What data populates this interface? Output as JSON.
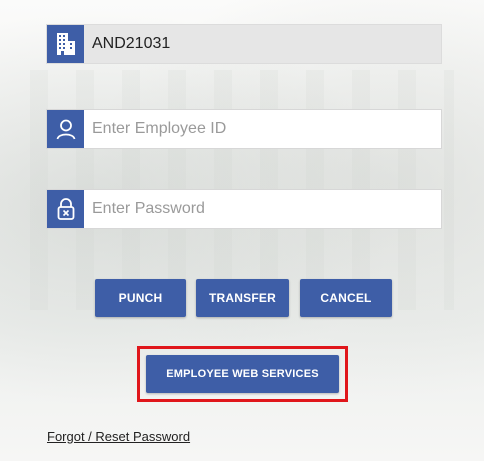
{
  "login": {
    "organization": {
      "value": "AND21031",
      "icon": "building-icon"
    },
    "employee_id": {
      "value": "",
      "placeholder": "Enter Employee ID",
      "icon": "user-icon"
    },
    "password": {
      "value": "",
      "placeholder": "Enter Password",
      "icon": "lock-icon"
    }
  },
  "actions": {
    "punch_label": "PUNCH",
    "transfer_label": "TRANSFER",
    "cancel_label": "CANCEL",
    "employee_web_services_label": "EMPLOYEE WEB SERVICES"
  },
  "links": {
    "forgot_reset_password": "Forgot / Reset Password"
  },
  "colors": {
    "primary": "#3e5ea7",
    "highlight": "#e0161b"
  }
}
